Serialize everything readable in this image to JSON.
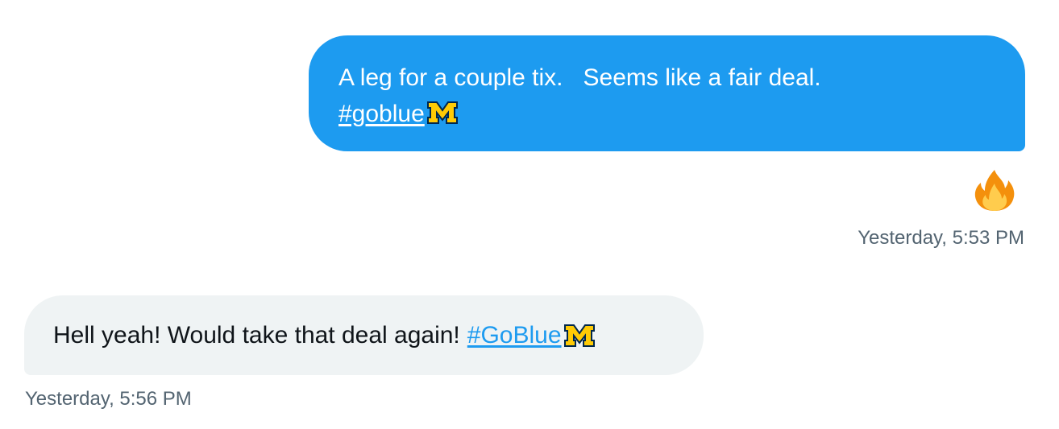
{
  "messages": [
    {
      "direction": "outgoing",
      "line1": "A leg for a couple tix.   Seems like a fair deal.",
      "hashtag": "#goblue",
      "emoji": "michigan-m-logo",
      "reaction": "fire-emoji",
      "timestamp": "Yesterday, 5:53 PM"
    },
    {
      "direction": "incoming",
      "text": "Hell yeah! Would take that deal again!",
      "hashtag": "#GoBlue",
      "emoji": "michigan-m-logo",
      "timestamp": "Yesterday, 5:56 PM"
    }
  ],
  "colors": {
    "outgoing_bubble": "#1d9bf0",
    "incoming_bubble": "#eff3f4",
    "link": "#1d9bf0",
    "timestamp": "#536471",
    "logo_maize": "#ffcb05",
    "logo_blue": "#00274c"
  }
}
